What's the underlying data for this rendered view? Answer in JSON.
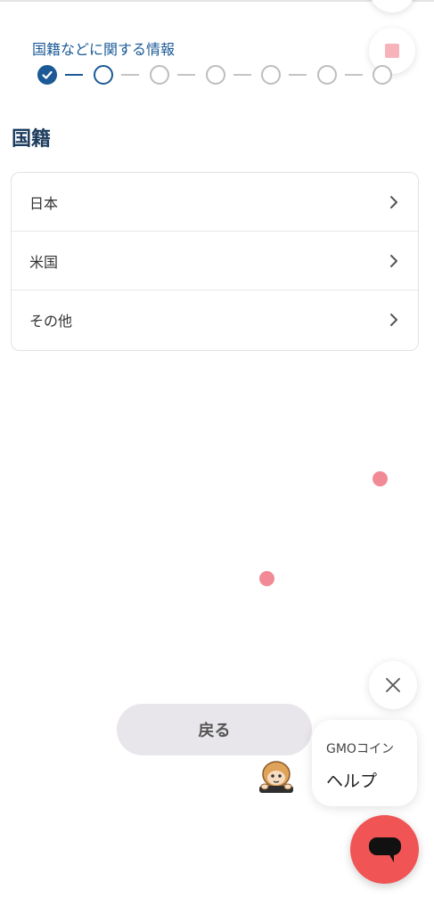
{
  "header": {
    "step_title": "国籍などに関する情報",
    "steps_total": 7,
    "steps_completed": 1,
    "current_step": 2
  },
  "page": {
    "title": "国籍"
  },
  "options": [
    {
      "label": "日本",
      "icon": "chevron-right-icon"
    },
    {
      "label": "米国",
      "icon": "chevron-right-icon"
    },
    {
      "label": "その他",
      "icon": "chevron-right-icon"
    }
  ],
  "footer": {
    "back_label": "戻る"
  },
  "help_widget": {
    "subtitle": "GMOコイン",
    "title": "ヘルプ",
    "close_icon": "close-icon",
    "chat_icon": "chat-bubble-icon"
  },
  "colors": {
    "primary": "#1b5a96",
    "title": "#1d3c5e",
    "accent_red": "#f05454",
    "dot_pink": "#f28a95",
    "button_gray": "#e8e6ea"
  }
}
